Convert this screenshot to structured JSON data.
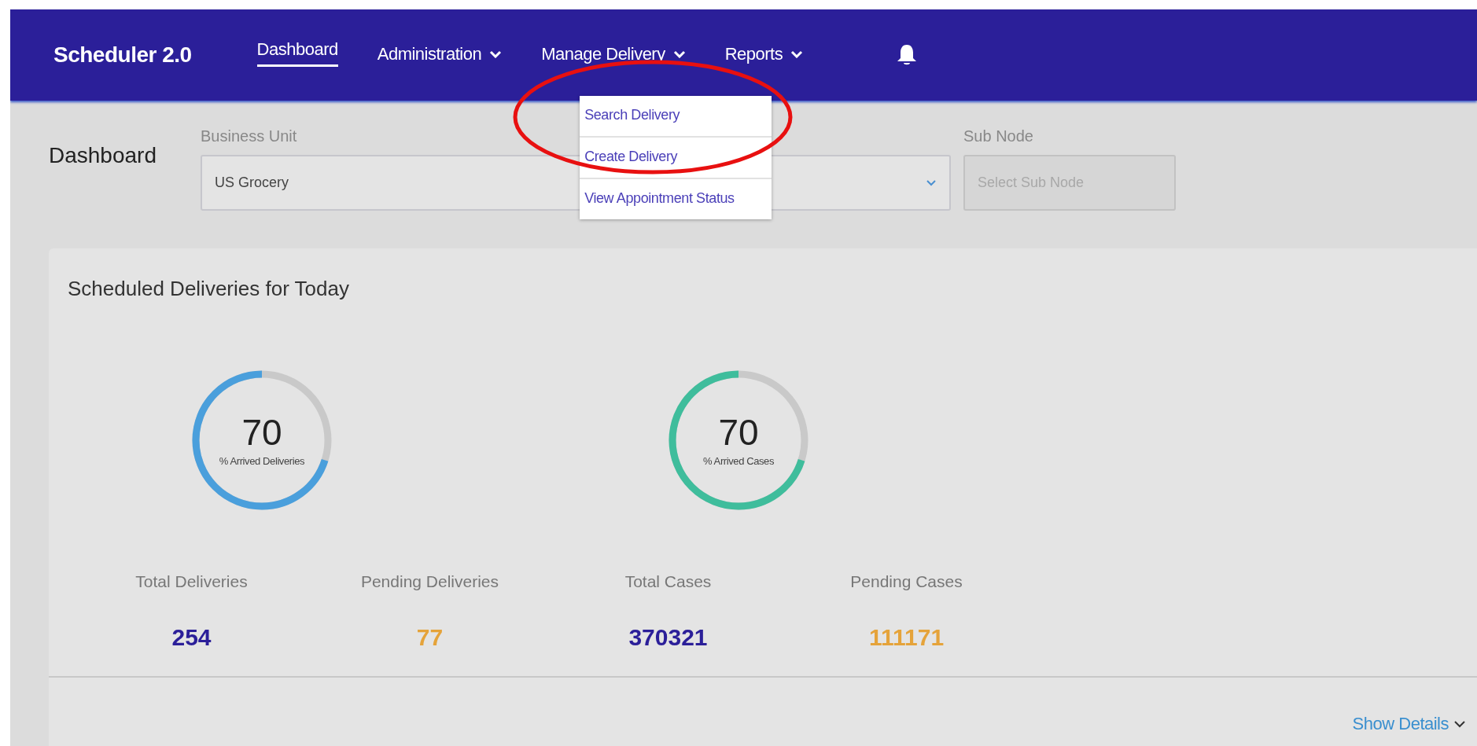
{
  "app_title": "Scheduler 2.0",
  "nav": [
    {
      "label": "Dashboard",
      "kind": "link",
      "selected": true
    },
    {
      "label": "Administration",
      "kind": "menu",
      "selected": false
    },
    {
      "label": "Manage Delivery",
      "kind": "menu",
      "selected": false,
      "menu": [
        "Search Delivery",
        "Create Delivery",
        "View Appointment Status"
      ]
    },
    {
      "label": "Reports",
      "kind": "menu",
      "selected": false
    }
  ],
  "page_title": "Dashboard",
  "filters": [
    {
      "label": "Business Unit",
      "value": "US Grocery",
      "disabled": false
    },
    {
      "label": "Sub Node",
      "placeholder": "Select Sub Node",
      "disabled": true
    }
  ],
  "card": {
    "title": "Scheduled Deliveries for Today",
    "gauges": [
      {
        "value": "70",
        "caption": "% Arrived Deliveries",
        "level": 0.7,
        "color": "#4a9fdc"
      },
      {
        "value": "70",
        "caption": "% Arrived Cases",
        "level": 0.7,
        "color": "#3fbd9c"
      }
    ],
    "stats": [
      {
        "label": "Total Deliveries",
        "value": "254",
        "color": "#2b1f99"
      },
      {
        "label": "Pending Deliveries",
        "value": "77",
        "color": "#e5a33a"
      },
      {
        "label": "Total Cases",
        "value": "370321",
        "color": "#2b1f99"
      },
      {
        "label": "Pending Cases",
        "value": "111171",
        "color": "#e5a33a"
      }
    ],
    "show_details": "Show Details"
  }
}
